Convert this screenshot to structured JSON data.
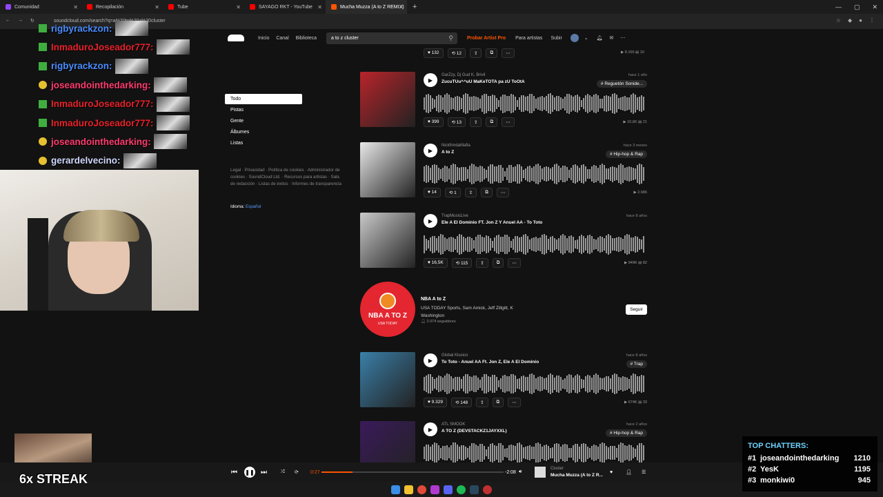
{
  "browser": {
    "tabs": [
      {
        "label": "Comunidad",
        "active": false,
        "color": "#9147ff"
      },
      {
        "label": "Recopilación",
        "active": false,
        "color": "#ff0000"
      },
      {
        "label": "Tube",
        "active": false,
        "color": "#ff0000"
      },
      {
        "label": "SAYAGO RKT - YouTube",
        "active": false,
        "color": "#ff0000"
      },
      {
        "label": "Mucha Muzza (A to Z REMIX)",
        "active": true,
        "color": "#ff5500"
      }
    ],
    "url": "soundcloud.com/search?q=a%20to%20z%20cluster"
  },
  "soundcloud": {
    "nav": {
      "home": "Inicio",
      "feed": "Canal",
      "library": "Biblioteca",
      "search_value": "a to z cluster",
      "try_pro": "Probar Artist Pro",
      "for_artists": "Para artistas",
      "upload": "Subir"
    },
    "filters": [
      "Todo",
      "Pistas",
      "Gente",
      "Álbumes",
      "Listas"
    ],
    "footer_links": "Legal · Privacidad · Política de cookies · Administrador de cookies · SoundCloud Ltd. · Recursos para artistas · Sala de redacción · Listas de éxitos · Informes de transparencia",
    "language_label": "Idioma:",
    "language_value": "Español",
    "top_partial": {
      "likes": "132",
      "reposts": "12",
      "plays": "8.166",
      "comments": "10"
    },
    "tracks": [
      {
        "uploader": "GarZzy, Dj Gud K, Brivil",
        "title": "ZucuTUu^^uU MaKeTOTA pa zU ToOtA",
        "ago": "hace 1 año",
        "tag": "# Reguetón Sonide...",
        "likes": "399",
        "reposts": "13",
        "plays": "10,6K",
        "comments": "21",
        "art_color": "#b8242a"
      },
      {
        "uploader": "NickfrmdaMafia",
        "title": "A to Z",
        "ago": "hace 3 meses",
        "tag": "# Hip-hop & Rap",
        "likes": "14",
        "reposts": "1",
        "plays": "2.686",
        "comments": "",
        "art_color": "#e8e8e8"
      },
      {
        "uploader": "TrapMusicLive",
        "title": "Ele A El Dominio FT. Jon Z Y Anuel AA - To Toto",
        "ago": "hace 8 años",
        "tag": "",
        "likes": "16,5K",
        "reposts": "115",
        "plays": "949K",
        "comments": "82",
        "art_color": "#c9c9c9"
      },
      {
        "uploader": "Global Klusico",
        "title": "To Toto - Anuel AA Ft. Jon Z, Ele A El Dominio",
        "ago": "hace 8 años",
        "tag": "# Trap",
        "likes": "9.329",
        "reposts": "148",
        "plays": "674K",
        "comments": "33",
        "art_color": "#3a7fa8"
      },
      {
        "uploader": "ATL SMOOK",
        "title": "A TO Z (DEVSTACKZ1JAYXXL)",
        "ago": "hace 2 años",
        "tag": "# Hip-hop & Rap",
        "likes": "",
        "reposts": "",
        "plays": "",
        "comments": "",
        "art_color": "#3a1a5a"
      }
    ],
    "profile": {
      "name": "NBA A to Z",
      "subtitle": "USA TODAY Sports, Sam Amick, Jeff Zillgitt, K Washington",
      "followers": "2.074 seguidores",
      "follow_label": "Seguir",
      "logo_text": "NBA A TO Z",
      "logo_sub": "USA TODAY"
    }
  },
  "player": {
    "current_time": "0:27",
    "total_time": "-2:08",
    "progress": 0.17,
    "artist": "Cluster",
    "title": "Mucha Muzza (A to Z R..."
  },
  "chat": [
    {
      "user": "rigbyrackzon:",
      "color": "#4a8cff"
    },
    {
      "user": "InmaduroJoseador777:",
      "color": "#e8222a"
    },
    {
      "user": "rigbyrackzon:",
      "color": "#4a8cff"
    },
    {
      "user": "joseandointhedarking:",
      "color": "#ff3b6e"
    },
    {
      "user": "InmaduroJoseador777:",
      "color": "#e8222a"
    },
    {
      "user": "InmaduroJoseador777:",
      "color": "#e8222a"
    },
    {
      "user": "joseandointhedarking:",
      "color": "#ff3b6e"
    },
    {
      "user": "gerardelvecino:",
      "color": "#d0d8ff"
    }
  ],
  "overlay": {
    "streak": "6x STREAK",
    "top_chatters_title": "TOP CHATTERS:",
    "top_chatters": [
      {
        "rank": "#1",
        "name": "joseandointhedarking",
        "count": "1210"
      },
      {
        "rank": "#2",
        "name": "YesK",
        "count": "1195"
      },
      {
        "rank": "#3",
        "name": "monkiwi0",
        "count": "945"
      }
    ]
  }
}
